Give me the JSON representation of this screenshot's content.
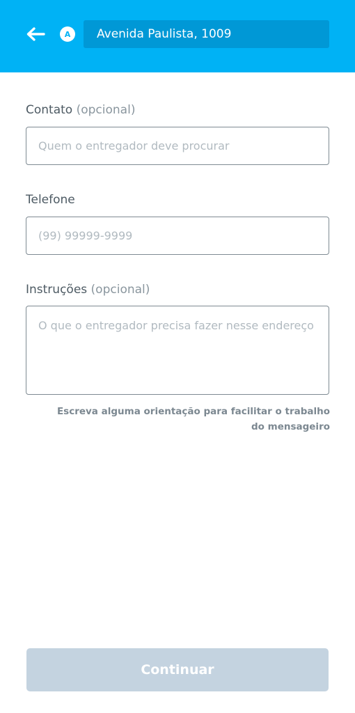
{
  "header": {
    "back_icon": "arrow-left-icon",
    "marker_letter": "A",
    "address": "Avenida Paulista, 1009",
    "background_color": "#00b2f5"
  },
  "form": {
    "contact": {
      "label": "Contato",
      "optional": "(opcional)",
      "placeholder": "Quem o entregador deve procurar",
      "value": ""
    },
    "phone": {
      "label": "Telefone",
      "placeholder": "(99) 99999-9999",
      "value": ""
    },
    "instructions": {
      "label": "Instruções",
      "optional": "(opcional)",
      "placeholder": "O que o entregador precisa fazer nesse endereço",
      "value": "",
      "hint": "Escreva alguma orientação para facilitar o trabalho do mensageiro"
    }
  },
  "footer": {
    "continue_label": "Continuar",
    "continue_color": "#c4d3e0"
  }
}
